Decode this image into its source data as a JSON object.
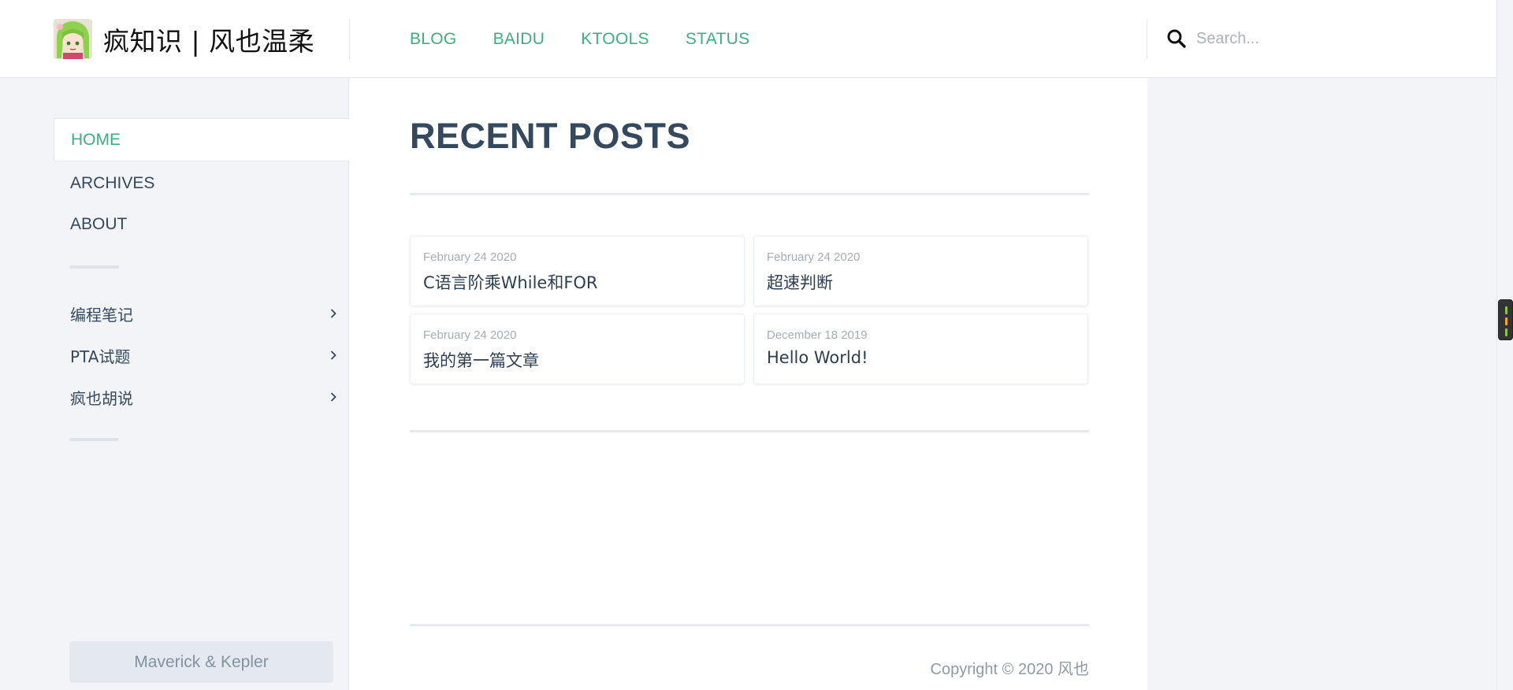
{
  "header": {
    "site_title": "疯知识 | 风也温柔",
    "nav": [
      "BLOG",
      "BAIDU",
      "KTOOLS",
      "STATUS"
    ],
    "search": {
      "placeholder": "Search...",
      "value": ""
    }
  },
  "sidebar": {
    "items": [
      {
        "label": "HOME",
        "active": true
      },
      {
        "label": "ARCHIVES",
        "active": false
      },
      {
        "label": "ABOUT",
        "active": false
      }
    ],
    "categories": [
      "编程笔记",
      "PTA试题",
      "疯也胡说"
    ],
    "footer": "Maverick & Kepler"
  },
  "main": {
    "title": "RECENT POSTS",
    "posts": [
      {
        "date": "February 24 2020",
        "title": "C语言阶乘While和FOR"
      },
      {
        "date": "February 24 2020",
        "title": "超速判断"
      },
      {
        "date": "February 24 2020",
        "title": "我的第一篇文章"
      },
      {
        "date": "December 18 2019",
        "title": "Hello World!"
      }
    ],
    "copyright": "Copyright © 2020 风也"
  },
  "colors": {
    "accent": "#3eaf7c",
    "text": "#34495e",
    "sidebar_bg": "#f2f4f7"
  }
}
